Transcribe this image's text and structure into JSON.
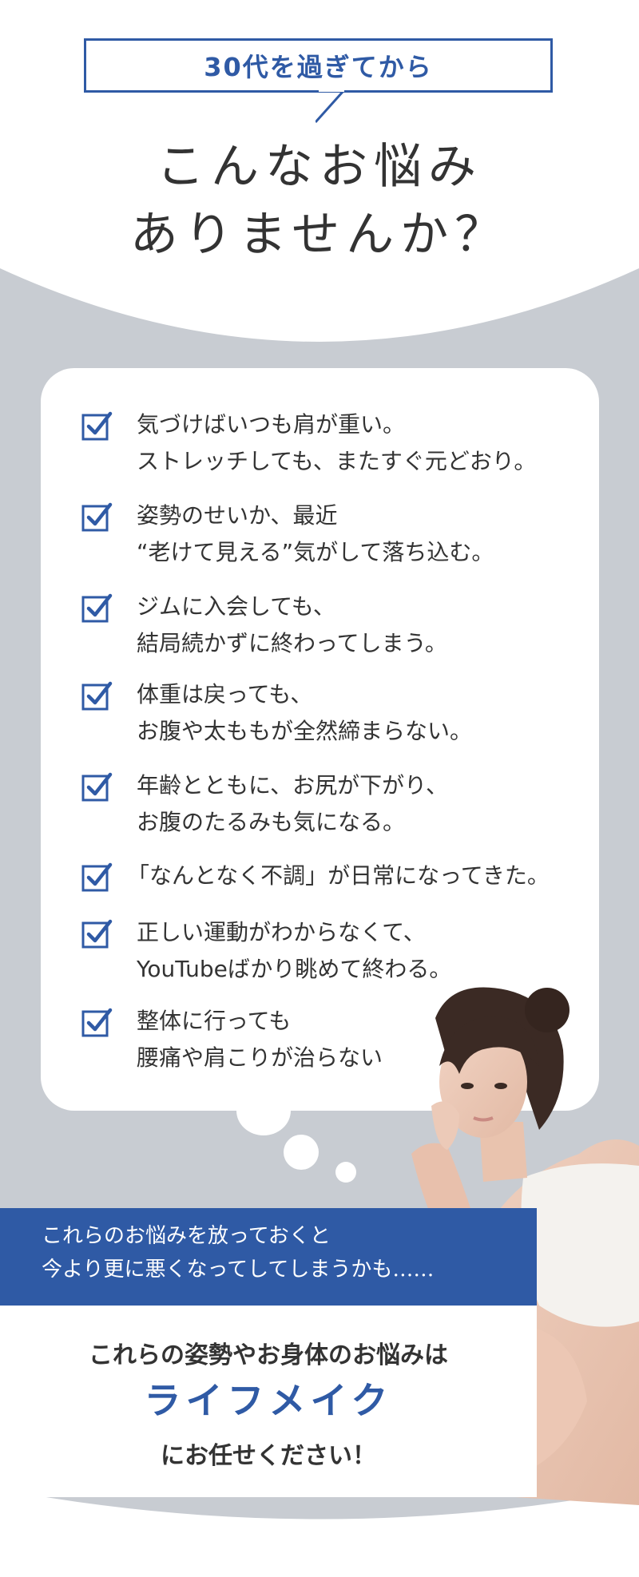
{
  "header": {
    "tag": "30代を過ぎてから",
    "headline_line1": "こんなお悩み",
    "headline_line2": "ありませんか？"
  },
  "worries": [
    {
      "line1": "気づけばいつも肩が重い。",
      "line2": "ストレッチしても、またすぐ元どおり。"
    },
    {
      "line1": "姿勢のせいか、最近",
      "line2": "“老けて見える”気がして落ち込む。"
    },
    {
      "line1": "ジムに入会しても、",
      "line2": "結局続かずに終わってしまう。"
    },
    {
      "line1": "体重は戻っても、",
      "line2": "お腹や太ももが全然締まらない。"
    },
    {
      "line1": "年齢とともに、お尻が下がり、",
      "line2": "お腹のたるみも気になる。"
    },
    {
      "line1": "「なんとなく不調」が日常になってきた。",
      "line2": ""
    },
    {
      "line1": "正しい運動がわからなくて、",
      "line2": "YouTubeばかり眺めて終わる。"
    },
    {
      "line1": "整体に行っても",
      "line2": "腰痛や肩こりが治らない"
    }
  ],
  "banner": {
    "line1": "これらのお悩みを放っておくと",
    "line2": "今より更に悪くなってしてしまうかも……"
  },
  "cta": {
    "line1": "これらの姿勢やお身体のお悩みは",
    "brand": "ライフメイク",
    "line3": "にお任せください！"
  },
  "colors": {
    "accent": "#2f5aa5",
    "background": "#c8ccd2",
    "text": "#333333"
  },
  "icons": {
    "check": "checkbox-checked-icon"
  }
}
